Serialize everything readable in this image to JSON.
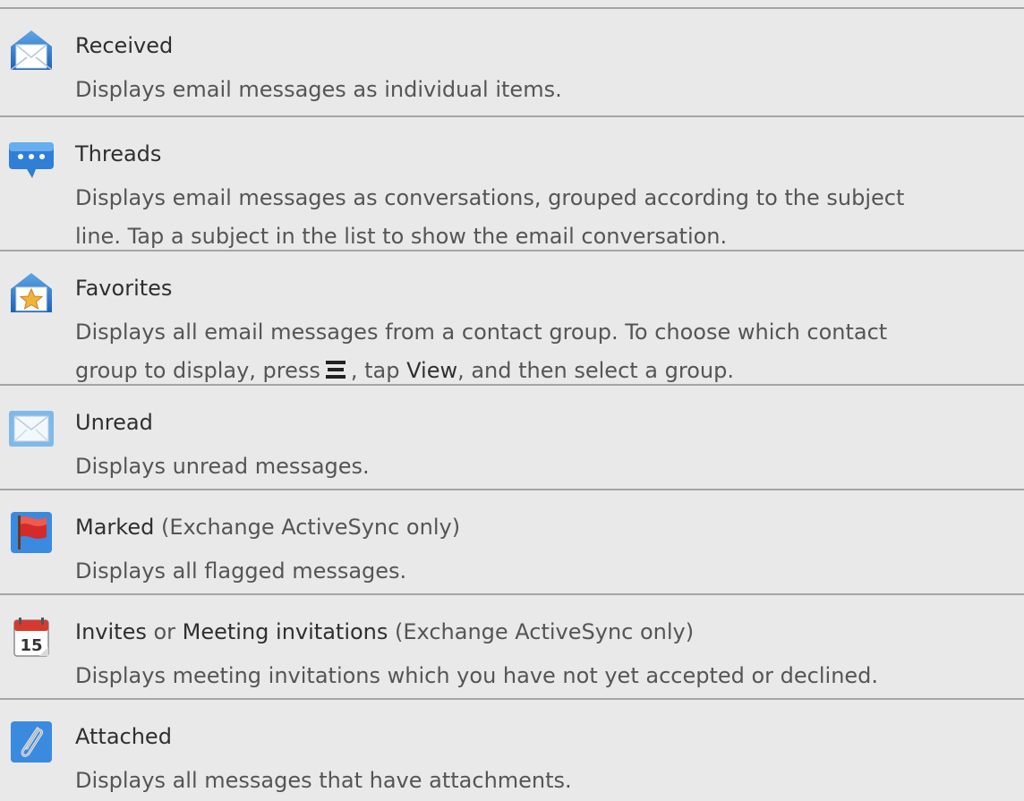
{
  "entries": [
    {
      "icon": "received-mail-icon",
      "title": "Received",
      "desc_line_1": "Displays email messages as individual items."
    },
    {
      "icon": "threads-speech-bubble-icon",
      "title": "Threads",
      "desc_line_1": "Displays email messages as conversations, grouped according to the subject",
      "desc_line_2": "line. Tap a subject in the list to show the email conversation."
    },
    {
      "icon": "favorites-star-mail-icon",
      "title": "Favorites",
      "desc_line_1": "Displays all email messages from a contact group. To choose which contact",
      "desc_line_2_a": "group to display, press",
      "desc_line_2_b": ", tap",
      "desc_line_2_view": "View",
      "desc_line_2_c": ", and then select a group.",
      "inline_icon": "menu-icon"
    },
    {
      "icon": "unread-envelope-icon",
      "title": "Unread",
      "desc_line_1": "Displays unread messages."
    },
    {
      "icon": "red-flag-icon",
      "title": "Marked",
      "title_suffix": " (Exchange ActiveSync only)",
      "desc_line_1": "Displays all flagged messages."
    },
    {
      "icon": "calendar-icon",
      "icon_text": "15",
      "title": "Invites",
      "title_or": " or ",
      "title_2": "Meeting invitations",
      "title_suffix": " (Exchange ActiveSync only)",
      "desc_line_1": "Displays meeting invitations which you have not yet accepted or declined."
    },
    {
      "icon": "paperclip-icon",
      "title": "Attached",
      "desc_line_1": "Displays all messages that have attachments."
    }
  ],
  "colors": {
    "background": "#e9e9e9",
    "rule": "#a5a5a5",
    "text_primary": "#2f2f2f",
    "text_secondary": "#555555"
  }
}
